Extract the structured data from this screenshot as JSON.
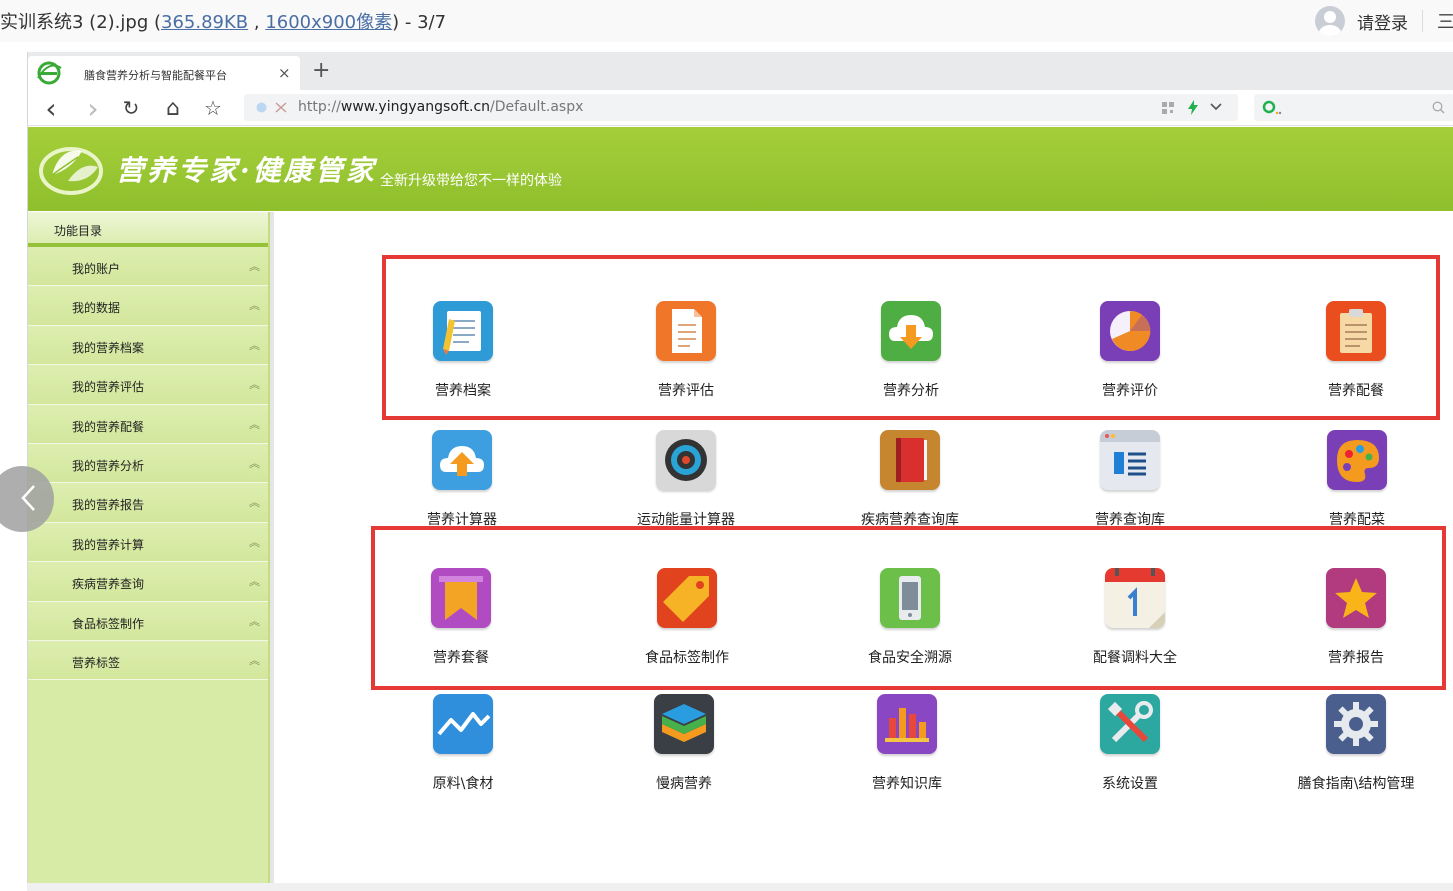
{
  "viewer": {
    "title_prefix": "实训系统3 (2).jpg (",
    "file_size": "365.89KB",
    "comma": " , ",
    "dimensions": "1600x900像素",
    "title_suffix": ") - 3/7",
    "login": "请登录",
    "menu_glyph": "三"
  },
  "browser": {
    "tab_title": "膳食营养分析与智能配餐平台",
    "tab_close": "×",
    "new_tab": "+",
    "url_prefix": "http://",
    "url_host": "www.yingyangsoft.cn",
    "url_path": "/Default.aspx",
    "nav": {
      "back": "‹",
      "forward": "›",
      "reload": "↻",
      "home": "⌂",
      "bookmark": "☆"
    }
  },
  "site": {
    "brand": "营养专家·健康管家",
    "slogan": "全新升级带给您不一样的体验"
  },
  "sidebar": {
    "header": "功能目录",
    "items": [
      {
        "label": "我的账户"
      },
      {
        "label": "我的数据"
      },
      {
        "label": "我的营养档案"
      },
      {
        "label": "我的营养评估"
      },
      {
        "label": "我的营养配餐"
      },
      {
        "label": "我的营养分析"
      },
      {
        "label": "我的营养报告"
      },
      {
        "label": "我的营养计算"
      },
      {
        "label": "疾病营养查询"
      },
      {
        "label": "食品标签制作"
      },
      {
        "label": "营养标签"
      }
    ],
    "chevron": "︽"
  },
  "grid": {
    "rows": [
      [
        {
          "label": "营养档案",
          "icon": "notebook-icon",
          "color": "#2f9bd6"
        },
        {
          "label": "营养评估",
          "icon": "document-icon",
          "color": "#f0772a"
        },
        {
          "label": "营养分析",
          "icon": "cloud-download-icon",
          "color": "#4fae43"
        },
        {
          "label": "营养评价",
          "icon": "pie-chart-icon",
          "color": "#7a3fb7"
        },
        {
          "label": "营养配餐",
          "icon": "clipboard-icon",
          "color": "#ea4e1f"
        }
      ],
      [
        {
          "label": "营养计算器",
          "icon": "cloud-upload-icon",
          "color": "#3d9ee0"
        },
        {
          "label": "运动能量计算器",
          "icon": "target-icon",
          "color": "#d8d8d8"
        },
        {
          "label": "疾病营养查询库",
          "icon": "book-icon",
          "color": "#c6862f"
        },
        {
          "label": "营养查询库",
          "icon": "list-window-icon",
          "color": "#e5e9ef"
        },
        {
          "label": "营养配菜",
          "icon": "palette-icon",
          "color": "#7a3fb7"
        }
      ],
      [
        {
          "label": "营养套餐",
          "icon": "bookmark-icon",
          "color": "#b04bc2"
        },
        {
          "label": "食品标签制作",
          "icon": "tag-icon",
          "color": "#e0431d"
        },
        {
          "label": "食品安全溯源",
          "icon": "phone-icon",
          "color": "#6cbf48"
        },
        {
          "label": "配餐调料大全",
          "icon": "calendar-icon",
          "color": "#f4f0e4"
        },
        {
          "label": "营养报告",
          "icon": "star-icon",
          "color": "#b23a7f"
        }
      ],
      [
        {
          "label": "原料\\食材",
          "icon": "line-chart-icon",
          "color": "#2f8fdc"
        },
        {
          "label": "慢病营养",
          "icon": "layers-icon",
          "color": "#3a3f45"
        },
        {
          "label": "营养知识库",
          "icon": "bar-chart-icon",
          "color": "#8a47c4"
        },
        {
          "label": "系统设置",
          "icon": "tools-icon",
          "color": "#2ca8a0"
        },
        {
          "label": "膳食指南\\结构管理",
          "icon": "gear-icon",
          "color": "#4b5f8e"
        }
      ]
    ]
  }
}
